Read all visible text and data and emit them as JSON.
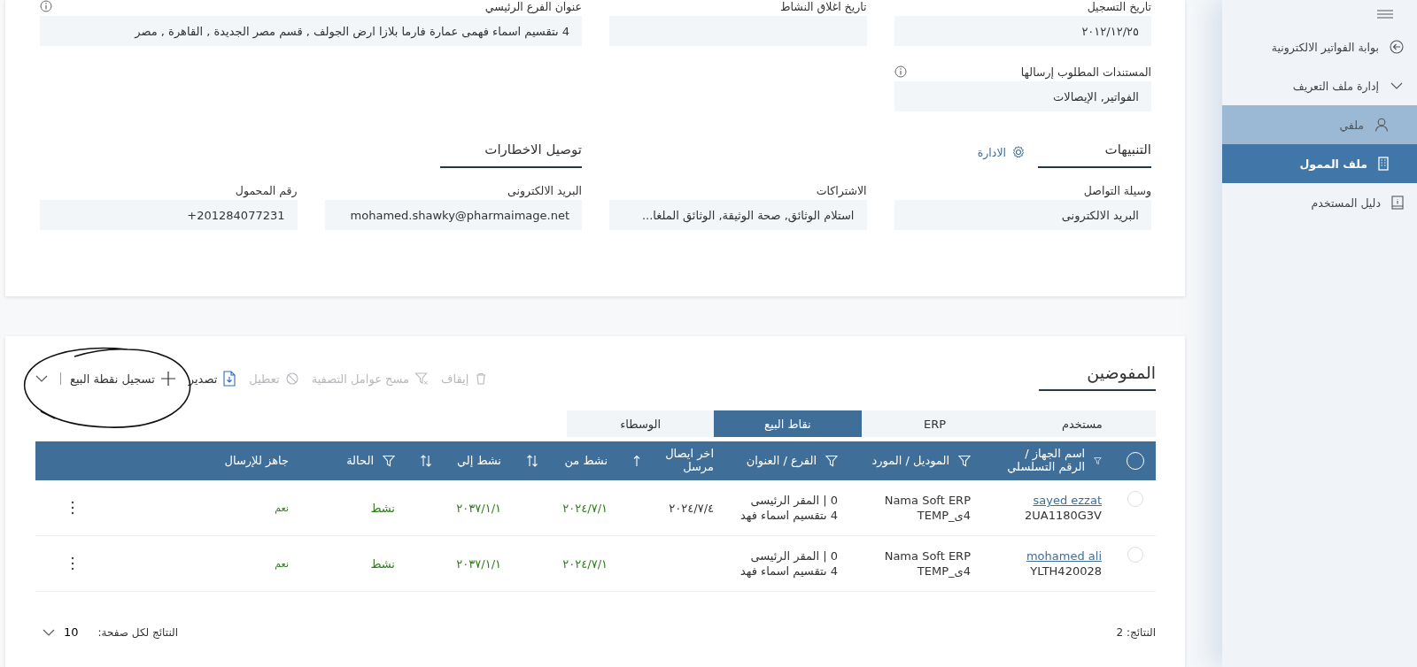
{
  "profile": {
    "fields": [
      {
        "label": "تاريخ التسجيل",
        "value": "٢٠١٢/١٢/٢٥"
      },
      {
        "label": "تاريخ اغلاق النشاط"
      },
      {
        "label": "عنوان الفرع الرئيسي",
        "value": "4 ىتقسيم اسماء فهمى عمارة فارما بلازا ارض الجولف , قسم مصر الجديدة , القاهرة , مصر",
        "info": true
      },
      {
        "label": "المستندات المطلوب إرسالها",
        "value": "الفواتير, الإيصالات",
        "info": true
      }
    ],
    "alerts": {
      "title": "التنبيهات",
      "manage_link": "الادارة",
      "fields": [
        {
          "label": "وسيلة التواصل",
          "value": "البريد الالكترونى"
        },
        {
          "label": "الاشتراكات",
          "value": "استلام الوثائق, صحة الوثيقة, الوثائق الملغا..."
        }
      ]
    },
    "notifications": {
      "title": "توصيل الاخطارات",
      "fields": [
        {
          "label": "البريد الالكترونى",
          "value": "mohamed.shawky@pharmaimage.net"
        },
        {
          "label": "رقم المحمول",
          "value": "+201284077231"
        }
      ]
    }
  },
  "delegates": {
    "title": "المفوضين",
    "toolbar": [
      {
        "label": "إيقاف",
        "disabled": true,
        "kind": "button"
      },
      {
        "label": "مسح عوامل التصفية",
        "disabled": true,
        "kind": "button"
      },
      {
        "label": "تعطيل",
        "disabled": true,
        "kind": "button"
      },
      {
        "label": "تصدير",
        "disabled": false,
        "kind": "button"
      },
      {
        "label": "تسجيل نقطة البيع",
        "disabled": false,
        "kind": "split"
      }
    ],
    "tabs": [
      {
        "label": "مستخدم",
        "selected": false
      },
      {
        "label": "ERP",
        "selected": false
      },
      {
        "label": "نقاط البيع",
        "selected": true
      },
      {
        "label": "الوسطاء",
        "selected": false
      }
    ],
    "table": {
      "all_selected": false,
      "columns": [
        {
          "label": "اسم الجهاز / الرقم التسلسلي",
          "kind": "filter"
        },
        {
          "label": "الموديل / المورد",
          "kind": "filter"
        },
        {
          "label": "الفرع / العنوان",
          "kind": "filter"
        },
        {
          "label": "اخر ايصال مرسل",
          "kind": "sorted"
        },
        {
          "label": "نشط من",
          "kind": "sort"
        },
        {
          "label": "نشط إلي",
          "kind": "sort"
        },
        {
          "label": "الحالة",
          "kind": "filter"
        },
        {
          "label": "جاهز للإرسال",
          "kind": "plain"
        }
      ],
      "rows": [
        {
          "selected": false,
          "name": "sayed ezzat",
          "serial": "2UA1180G3V",
          "model": "Nama Soft ERP",
          "vendor": "4ى_TEMP",
          "branch": "0 | المقر الرئيسى",
          "address": "4 ىتقسيم اسماء فهد",
          "last_receipt": "٢٠٢٤/٧/٤",
          "active_from": "٢٠٢٤/٧/١",
          "active_to": "٢٠٣٧/١/١",
          "status": "نشط",
          "ready": "نعم"
        },
        {
          "selected": false,
          "name": "mohamed ali",
          "serial": "YLTH420028",
          "model": "Nama Soft ERP",
          "vendor": "4ى_TEMP",
          "branch": "0 | المقر الرئيسى",
          "address": "4 ىتقسيم اسماء فهد",
          "active_from": "٢٠٢٤/٧/١",
          "active_to": "٢٠٣٧/١/١",
          "status": "نشط",
          "ready": "نعم"
        }
      ]
    },
    "footer": {
      "results": "النتائج: 2",
      "per_page_label": "النتائج لكل صفحة:",
      "per_page": "10"
    }
  },
  "sidebar": {
    "items": [
      {
        "label": "بوابة الفواتير الالكترونية",
        "selected": false
      },
      {
        "label": "إدارة ملف التعريف",
        "selected": false,
        "expanded": true,
        "children": [
          {
            "label": "ملفي",
            "selected": false,
            "hovered": true
          },
          {
            "label": "ملف الممول",
            "selected": true,
            "hovered": false
          }
        ]
      },
      {
        "label": "دليل المستخدم",
        "selected": false
      }
    ]
  }
}
